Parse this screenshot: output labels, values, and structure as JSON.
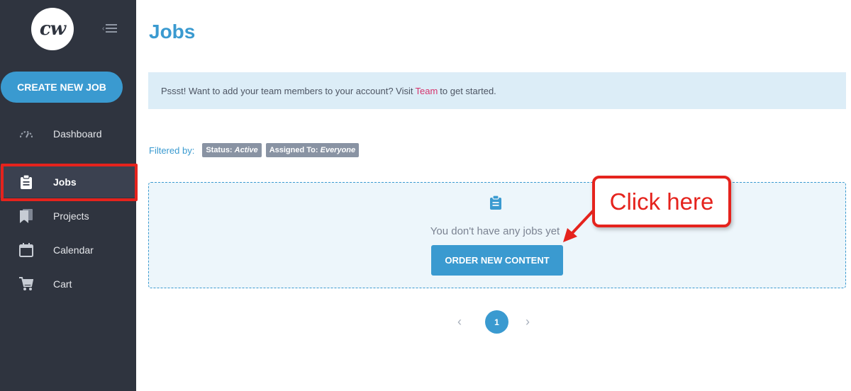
{
  "sidebar": {
    "logo_text": "cw",
    "create_button": "CREATE NEW JOB",
    "items": [
      {
        "label": "Dashboard",
        "icon": "dashboard-gauge-icon"
      },
      {
        "label": "Jobs",
        "icon": "clipboard-icon",
        "active": true
      },
      {
        "label": "Projects",
        "icon": "bookmark-icon"
      },
      {
        "label": "Calendar",
        "icon": "calendar-icon"
      },
      {
        "label": "Cart",
        "icon": "cart-icon"
      }
    ]
  },
  "main": {
    "title": "Jobs",
    "notice": {
      "before": "Pssst! Want to add your team members to your account? Visit",
      "link": "Team",
      "after": "to get started."
    },
    "filters": {
      "label": "Filtered by:",
      "status_key": "Status:",
      "status_value": "Active",
      "assigned_key": "Assigned To:",
      "assigned_value": "Everyone"
    },
    "empty_state": {
      "text": "You don't have any jobs yet",
      "button": "ORDER NEW CONTENT",
      "icon": "clipboard-icon"
    },
    "pagination": {
      "prev": "‹",
      "current_page": "1",
      "next": "›"
    }
  },
  "annotation": {
    "callout_text": "Click here"
  },
  "colors": {
    "sidebar_bg": "#2f343f",
    "accent": "#3a9ad0",
    "annotation_red": "#e5231d",
    "link_pink": "#d6336c"
  }
}
